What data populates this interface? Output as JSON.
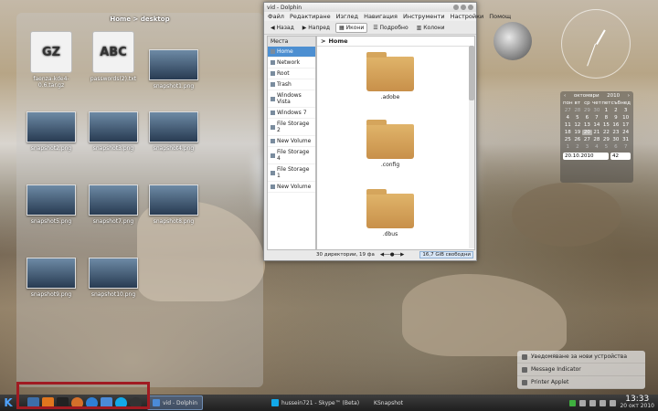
{
  "folderview": {
    "title": "Home > desktop",
    "items": [
      {
        "label": "faenza-kde4-0.6.tar.gz",
        "type": "archive",
        "thumb_text": "GZ"
      },
      {
        "label": "passwords(2).txt",
        "type": "text",
        "thumb_text": "ABC"
      },
      {
        "label": "snapshot1.png",
        "type": "image"
      },
      {
        "label": "snapshot2.png",
        "type": "image"
      },
      {
        "label": "snapshot3.png",
        "type": "image"
      },
      {
        "label": "snapshot4.png",
        "type": "image"
      },
      {
        "label": "snapshot5.png",
        "type": "image"
      },
      {
        "label": "snapshot7.png",
        "type": "image"
      },
      {
        "label": "snapshot8.png",
        "type": "image"
      },
      {
        "label": "snapshot9.png",
        "type": "image"
      },
      {
        "label": "snapshot10.png",
        "type": "image"
      }
    ]
  },
  "dolphin": {
    "title": "vid - Dolphin",
    "menu": [
      "Файл",
      "Редактиране",
      "Изглед",
      "Навигация",
      "Инструменти",
      "Настройки",
      "Помощ"
    ],
    "toolbar": {
      "back": "Назад",
      "forward": "Напред",
      "icons": "Икони",
      "details": "Подробно",
      "columns": "Колони"
    },
    "places_header": "Места",
    "places": [
      "Home",
      "Network",
      "Root",
      "Trash",
      "Windows Vista",
      "Windows 7",
      "File Storage 2",
      "New Volume",
      "File Storage 4",
      "File Storage 1",
      "New Volume"
    ],
    "breadcrumb": "Home",
    "folders": [
      ".adobe",
      ".config",
      ".dbus"
    ],
    "status": "30 директории, 19 фа",
    "free_space": "16,7 GiB свободни"
  },
  "calendar": {
    "month": "октомври",
    "year": "2010",
    "weekdays": [
      "пон",
      "вт",
      "ср",
      "чет",
      "пет",
      "съб",
      "нед"
    ],
    "days": [
      "27",
      "28",
      "29",
      "30",
      "1",
      "2",
      "3",
      "4",
      "5",
      "6",
      "7",
      "8",
      "9",
      "10",
      "11",
      "12",
      "13",
      "14",
      "15",
      "16",
      "17",
      "18",
      "19",
      "20",
      "21",
      "22",
      "23",
      "24",
      "25",
      "26",
      "27",
      "28",
      "29",
      "30",
      "31",
      "1",
      "2",
      "3",
      "4",
      "5",
      "6",
      "7"
    ],
    "date_input": "20.10.2010",
    "week": "42"
  },
  "notifications": [
    {
      "label": "Уведомяване за нови устройства"
    },
    {
      "label": "Message Indicator"
    },
    {
      "label": "Printer Applet"
    }
  ],
  "panel": {
    "tasks": [
      {
        "label": "vid - Dolphin",
        "active": true
      },
      {
        "label": "hussein721 - Skype™ (Beta)",
        "active": false
      },
      {
        "label": "KSnapshot",
        "active": false
      }
    ],
    "clock_time": "13:33",
    "clock_date": "20 окт 2010"
  },
  "colors": {
    "highlight": "#a01b22",
    "selection": "#4d8fd1"
  }
}
